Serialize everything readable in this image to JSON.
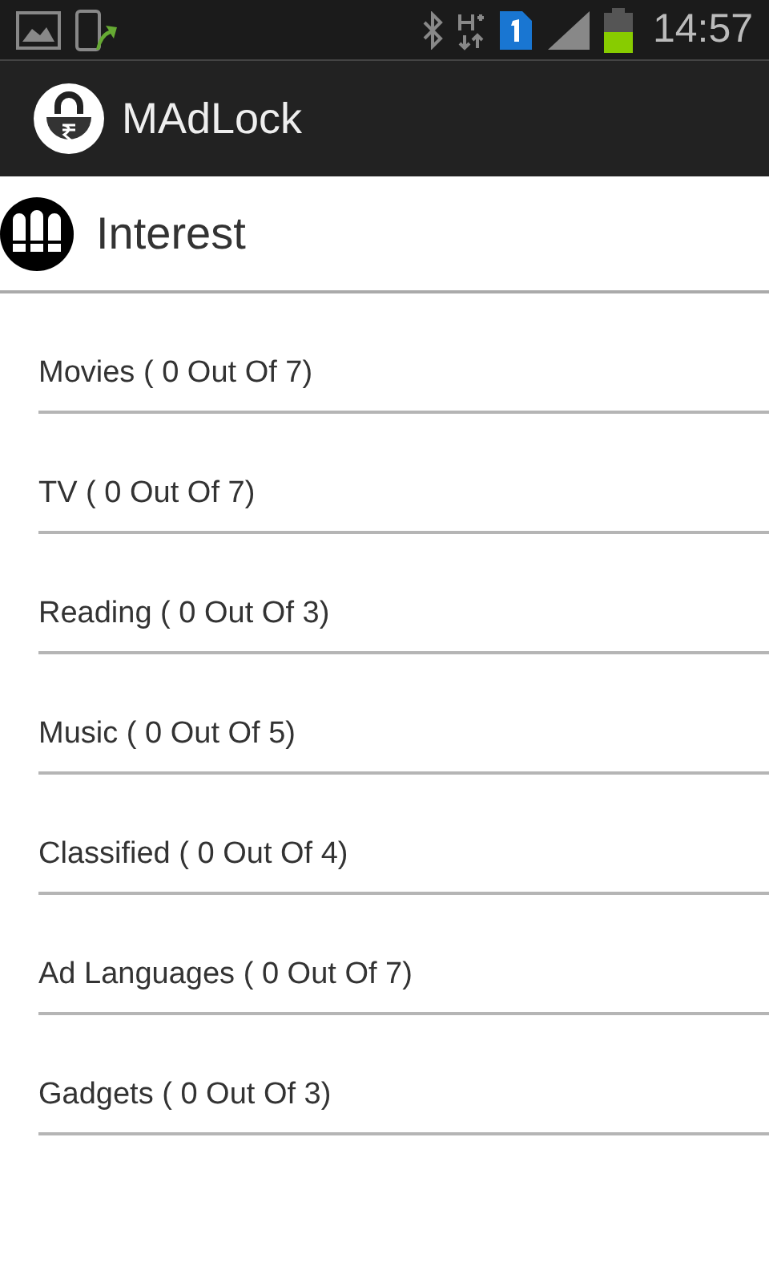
{
  "status_bar": {
    "time": "14:57"
  },
  "app_bar": {
    "title": "MAdLock"
  },
  "section": {
    "title": "Interest"
  },
  "items": [
    {
      "label": "Movies ( 0 Out Of 7)"
    },
    {
      "label": "TV ( 0 Out Of 7)"
    },
    {
      "label": "Reading ( 0 Out Of 3)"
    },
    {
      "label": "Music ( 0 Out Of 5)"
    },
    {
      "label": "Classified ( 0 Out Of 4)"
    },
    {
      "label": "Ad Languages ( 0 Out Of 7)"
    },
    {
      "label": "Gadgets ( 0 Out Of 3)"
    }
  ]
}
